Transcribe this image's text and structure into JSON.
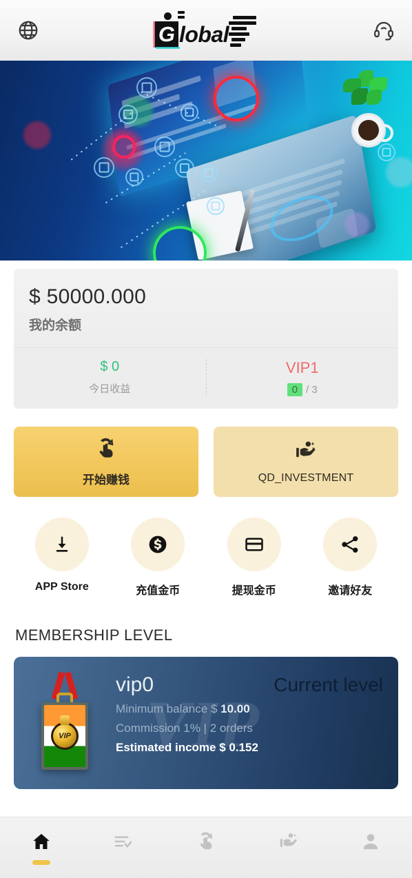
{
  "header": {
    "language_icon": "globe-icon",
    "support_icon": "headset-icon",
    "logo_g": "G",
    "logo_text": "lobal"
  },
  "banner": {
    "alt": "tech-workspace-banner"
  },
  "balance": {
    "amount": "$ 50000.000",
    "label": "我的余额",
    "today_income_value": "$ 0",
    "today_income_label": "今日收益",
    "vip_level": "VIP1",
    "orders_done": "0",
    "orders_total": "/ 3"
  },
  "gold_buttons": [
    {
      "label": "开始赚钱",
      "icon": "tap-hand-icon"
    },
    {
      "label": "QD_INVESTMENT",
      "icon": "hand-coins-icon"
    }
  ],
  "quick_actions": [
    {
      "label": "APP Store",
      "icon": "download-icon"
    },
    {
      "label": "充值金币",
      "icon": "dollar-coin-icon"
    },
    {
      "label": "提现金币",
      "icon": "credit-card-icon"
    },
    {
      "label": "邀请好友",
      "icon": "share-icon"
    }
  ],
  "membership": {
    "section_title": "MEMBERSHIP LEVEL",
    "watermark": "VIP",
    "level_name": "vip0",
    "current_badge": "Current level",
    "min_balance_label": "Minimum balance $",
    "min_balance_value": "10.00",
    "commission": "Commission 1% | 2 orders",
    "estimated_income": "Estimated income $ 0.152"
  },
  "bottom_nav": [
    {
      "name": "home",
      "icon": "home-icon",
      "active": true
    },
    {
      "name": "orders",
      "icon": "list-check-icon",
      "active": false
    },
    {
      "name": "earn",
      "icon": "tap-hand-icon",
      "active": false
    },
    {
      "name": "invest",
      "icon": "hand-coins-icon",
      "active": false
    },
    {
      "name": "profile",
      "icon": "person-icon",
      "active": false
    }
  ],
  "colors": {
    "gold": "#f0c44a",
    "green": "#2ec27e",
    "red": "#ef6b6b",
    "chip_green": "#5fe07a"
  }
}
